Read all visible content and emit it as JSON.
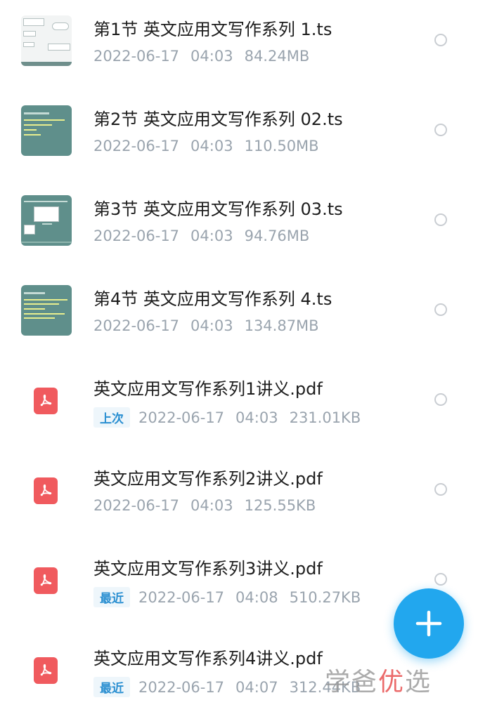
{
  "files": [
    {
      "title": "第1节 英文应用文写作系列 1.ts",
      "badge": "",
      "date": "2022-06-17",
      "time": "04:03",
      "size": "84.24MB",
      "icon": "video-thumbnail-doc"
    },
    {
      "title": "第2节 英文应用文写作系列 02.ts",
      "badge": "",
      "date": "2022-06-17",
      "time": "04:03",
      "size": "110.50MB",
      "icon": "video-thumbnail-slide"
    },
    {
      "title": "第3节 英文应用文写作系列 03.ts",
      "badge": "",
      "date": "2022-06-17",
      "time": "04:03",
      "size": "94.76MB",
      "icon": "video-thumbnail-slide"
    },
    {
      "title": "第4节 英文应用文写作系列 4.ts",
      "badge": "",
      "date": "2022-06-17",
      "time": "04:03",
      "size": "134.87MB",
      "icon": "video-thumbnail-slide"
    },
    {
      "title": "英文应用文写作系列1讲义.pdf",
      "badge": "上次",
      "date": "2022-06-17",
      "time": "04:03",
      "size": "231.01KB",
      "icon": "pdf-icon"
    },
    {
      "title": "英文应用文写作系列2讲义.pdf",
      "badge": "",
      "date": "2022-06-17",
      "time": "04:03",
      "size": "125.55KB",
      "icon": "pdf-icon"
    },
    {
      "title": "英文应用文写作系列3讲义.pdf",
      "badge": "最近",
      "date": "2022-06-17",
      "time": "04:08",
      "size": "510.27KB",
      "icon": "pdf-icon"
    },
    {
      "title": "英文应用文写作系列4讲义.pdf",
      "badge": "最近",
      "date": "2022-06-17",
      "time": "04:07",
      "size": "312.44KB",
      "icon": "pdf-icon"
    }
  ],
  "watermark": {
    "part1": "学爸",
    "part2": "优",
    "part3": "选"
  },
  "colors": {
    "accent": "#22a7ee",
    "pdf": "#f05a5e",
    "meta": "#9aa4ae",
    "badge": "#2a8fd1"
  }
}
